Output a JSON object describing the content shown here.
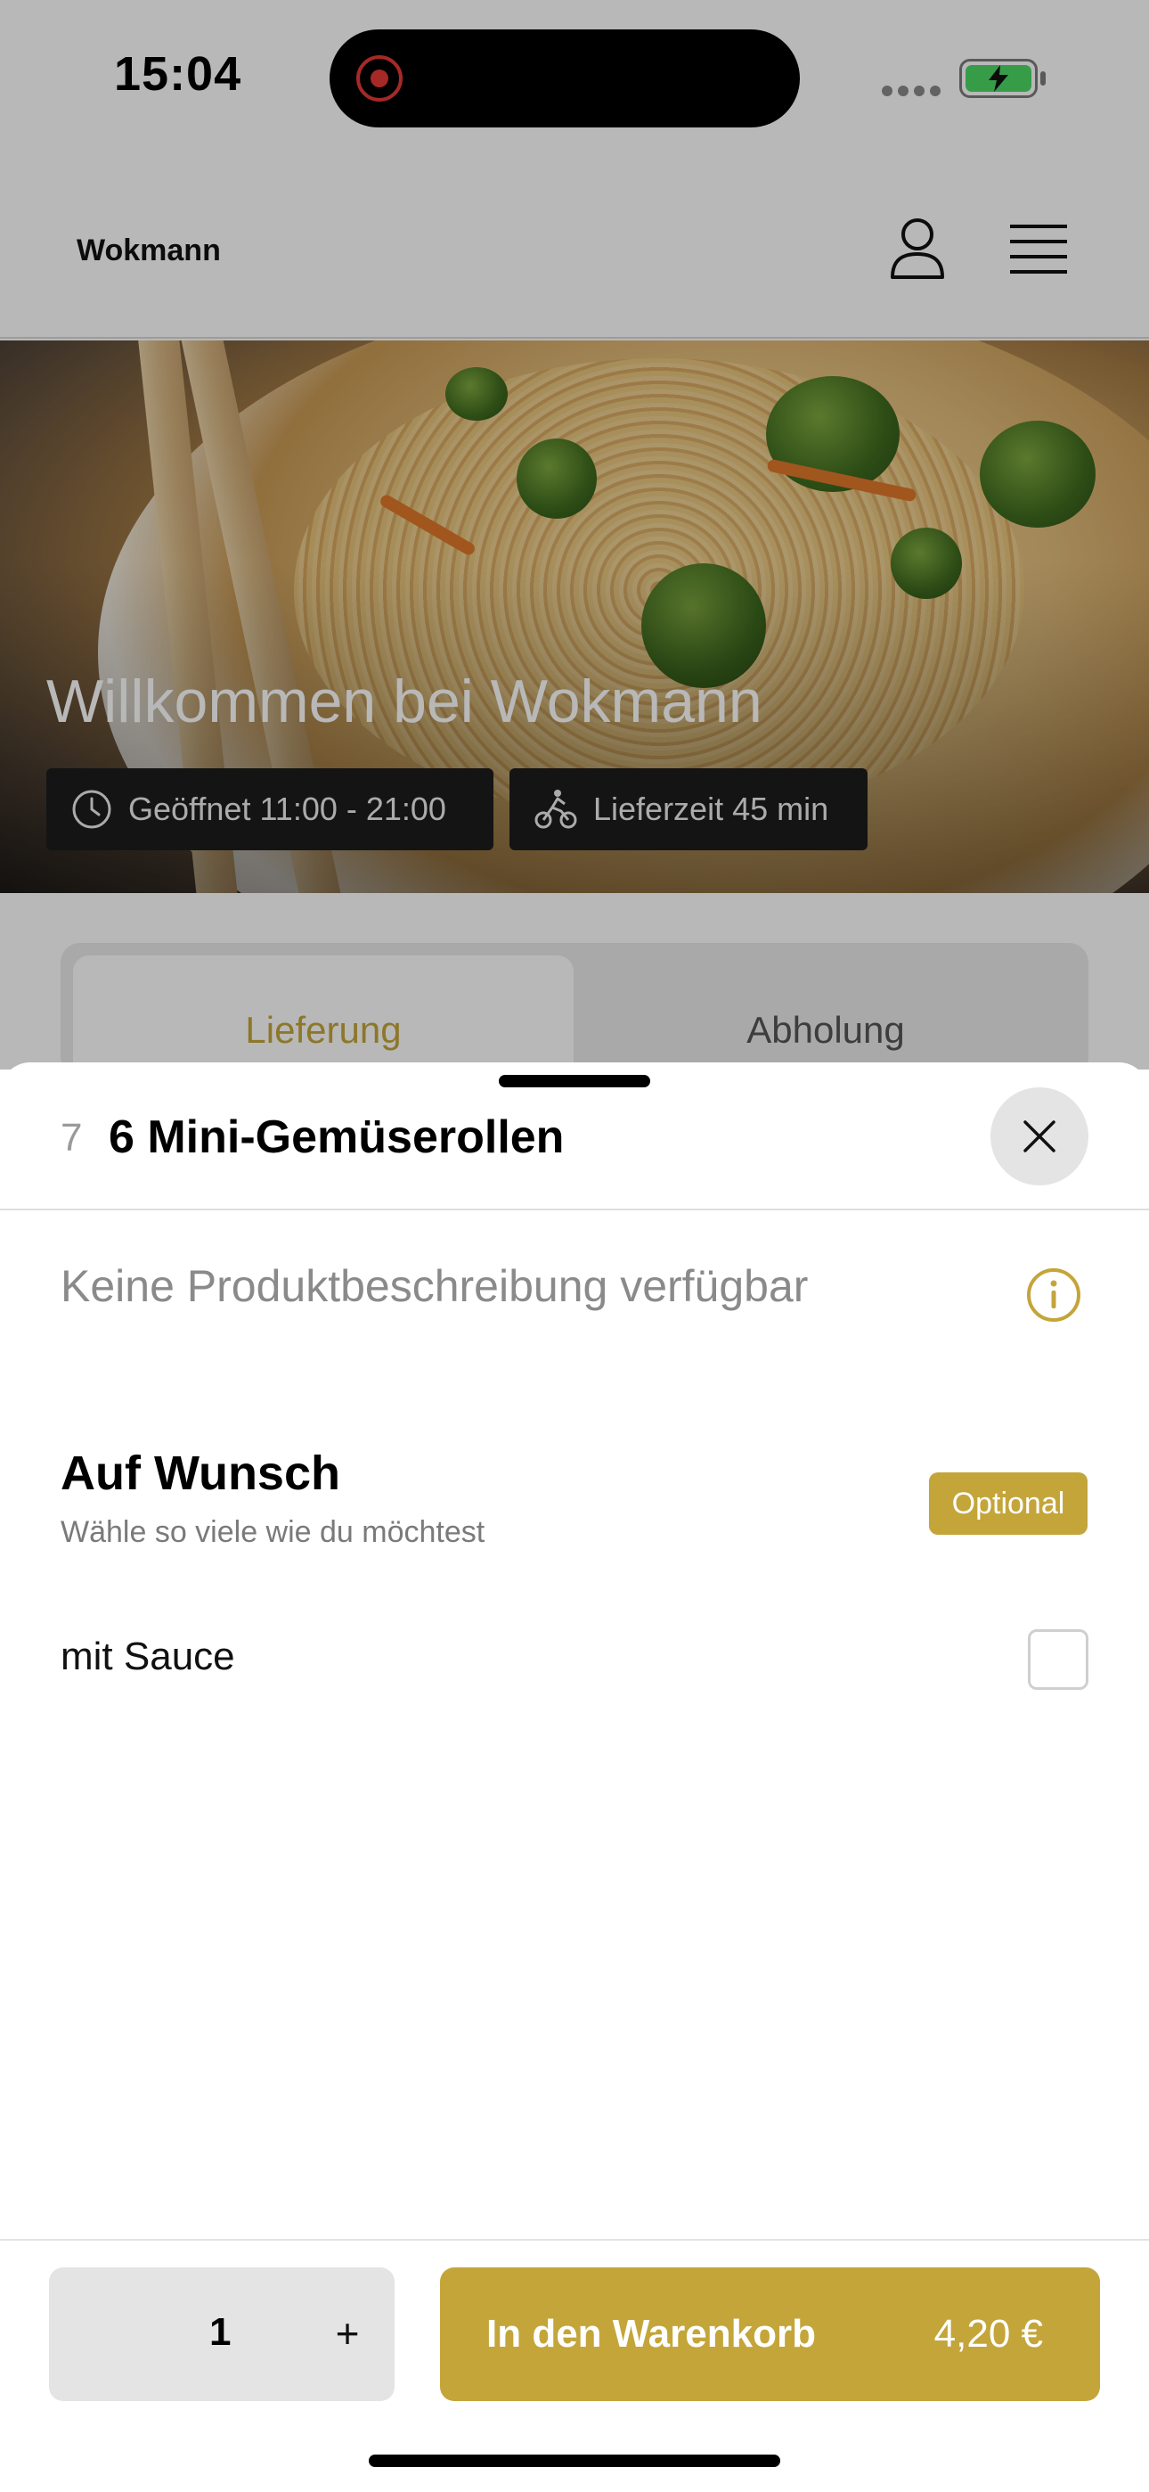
{
  "status_bar": {
    "time": "15:04"
  },
  "header": {
    "brand": "Wokmann"
  },
  "hero": {
    "title": "Willkommen bei Wokmann",
    "opening_hours": "Geöffnet 11:00 - 21:00",
    "delivery_time": "Lieferzeit 45 min"
  },
  "order_tabs": {
    "delivery": "Lieferung",
    "pickup": "Abholung",
    "active": "Lieferung"
  },
  "product": {
    "number": "7",
    "name": "6 Mini-Gemüserollen",
    "description": "Keine Produktbeschreibung verfügbar"
  },
  "options": {
    "heading": "Auf Wunsch",
    "subtitle": "Wähle so viele wie du möchtest",
    "badge": "Optional",
    "items": [
      {
        "label": "mit Sauce",
        "checked": false
      }
    ]
  },
  "footer": {
    "quantity": "1",
    "plus": "+",
    "add_to_cart": "In den Warenkorb",
    "price": "4,20 €"
  },
  "colors": {
    "accent": "#c4a53a",
    "battery": "#4cd964",
    "record": "#e53935"
  }
}
